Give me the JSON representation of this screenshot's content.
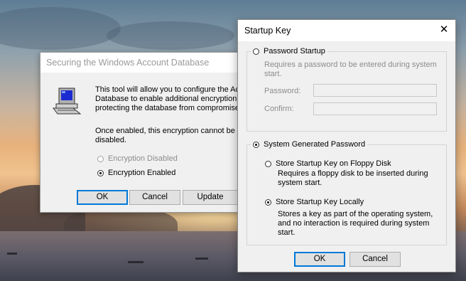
{
  "back_dialog": {
    "title": "Securing the Windows Account Database",
    "description": "This tool will allow you to configure the Acc\nDatabase to enable additional encryption, f\nprotecting the database from compromise.",
    "warning": "Once enabled, this encryption cannot be disabled.",
    "options": [
      {
        "label": "Encryption Disabled",
        "selected": false,
        "enabled": false
      },
      {
        "label": "Encryption Enabled",
        "selected": true,
        "enabled": true
      }
    ],
    "buttons": {
      "ok": "OK",
      "cancel": "Cancel",
      "update": "Update"
    }
  },
  "startup_dialog": {
    "title": "Startup Key",
    "close_glyph": "✕",
    "password_startup": {
      "label": "Password Startup",
      "selected": false,
      "description": "Requires a password to be entered during system start.",
      "password_label": "Password:",
      "password_value": "",
      "confirm_label": "Confirm:",
      "confirm_value": ""
    },
    "system_generated": {
      "label": "System Generated Password",
      "selected": true,
      "floppy": {
        "label": "Store Startup Key on Floppy Disk",
        "selected": false,
        "description": "Requires a floppy disk to be inserted during system start."
      },
      "local": {
        "label": "Store Startup Key Locally",
        "selected": true,
        "description": "Stores a key as part of the operating system, and no interaction is required during system start."
      }
    },
    "buttons": {
      "ok": "OK",
      "cancel": "Cancel"
    }
  },
  "icons": {
    "computer": "computer-icon",
    "close": "close-icon"
  },
  "colors": {
    "dialog_bg": "#f0f0f0",
    "default_button_border": "#0078d7",
    "disabled_text": "#8c8c8c"
  }
}
